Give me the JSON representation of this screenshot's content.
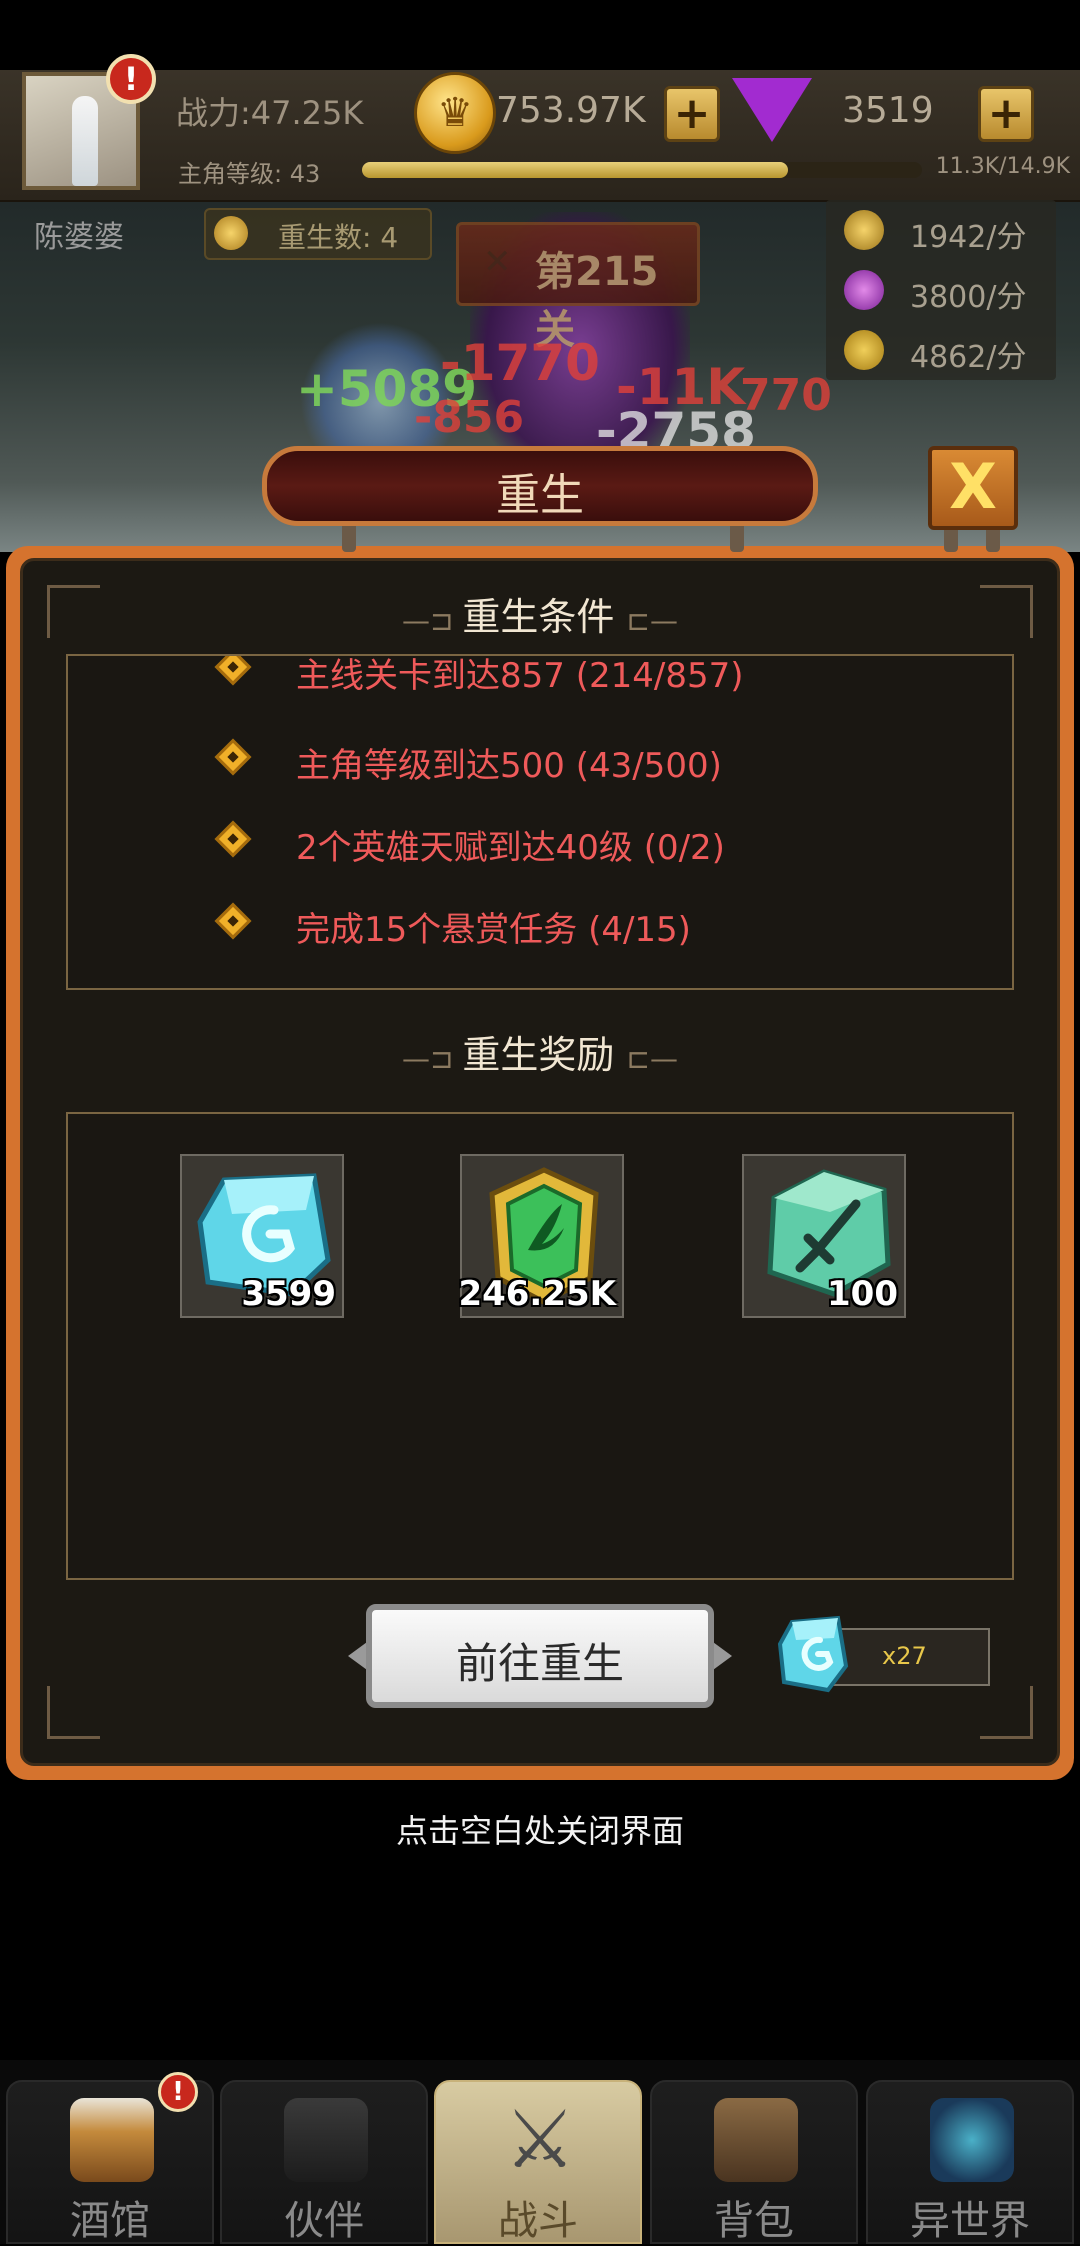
{
  "header": {
    "alert_icon": "!",
    "power": "战力:47.25K",
    "level_label": "主角等级: 43",
    "level_progress": 0.76,
    "xp": "11.3K/14.9K",
    "coins": "753.97K",
    "gems": "3519",
    "plus": "+"
  },
  "scene": {
    "hero_name": "陈婆婆",
    "rebirth_count": "重生数: 4",
    "stage": "第215关",
    "rates": [
      "1942/分",
      "3800/分",
      "4862/分"
    ],
    "damage_numbers": [
      "+5089",
      "-1770",
      "-856",
      "-11K",
      "-2758",
      "770"
    ]
  },
  "panel": {
    "title": "重生",
    "close_label": "X",
    "conditions_title": "重生条件",
    "conditions": [
      "主线关卡到达857 (214/857)",
      "主角等级到达500 (43/500)",
      "2个英雄天赋到达40级 (0/2)",
      "完成15个悬赏任务 (4/15)"
    ],
    "rewards_title": "重生奖励",
    "rewards": [
      {
        "icon": "rune-stone-icon",
        "amount": "3599"
      },
      {
        "icon": "green-crest-icon",
        "amount": "246.25K"
      },
      {
        "icon": "sword-tablet-icon",
        "amount": "100"
      }
    ],
    "goto_button": "前往重生",
    "cost_amount": "x27"
  },
  "hint": "点击空白处关闭界面",
  "nav": [
    {
      "label": "酒馆",
      "active": false
    },
    {
      "label": "伙伴",
      "active": false
    },
    {
      "label": "战斗",
      "active": true
    },
    {
      "label": "背包",
      "active": false
    },
    {
      "label": "异世界",
      "active": false
    }
  ],
  "colors": {
    "accent_orange": "#d5732e",
    "condition_red": "#ef5a5a",
    "cost_yellow": "#e8c74a"
  }
}
